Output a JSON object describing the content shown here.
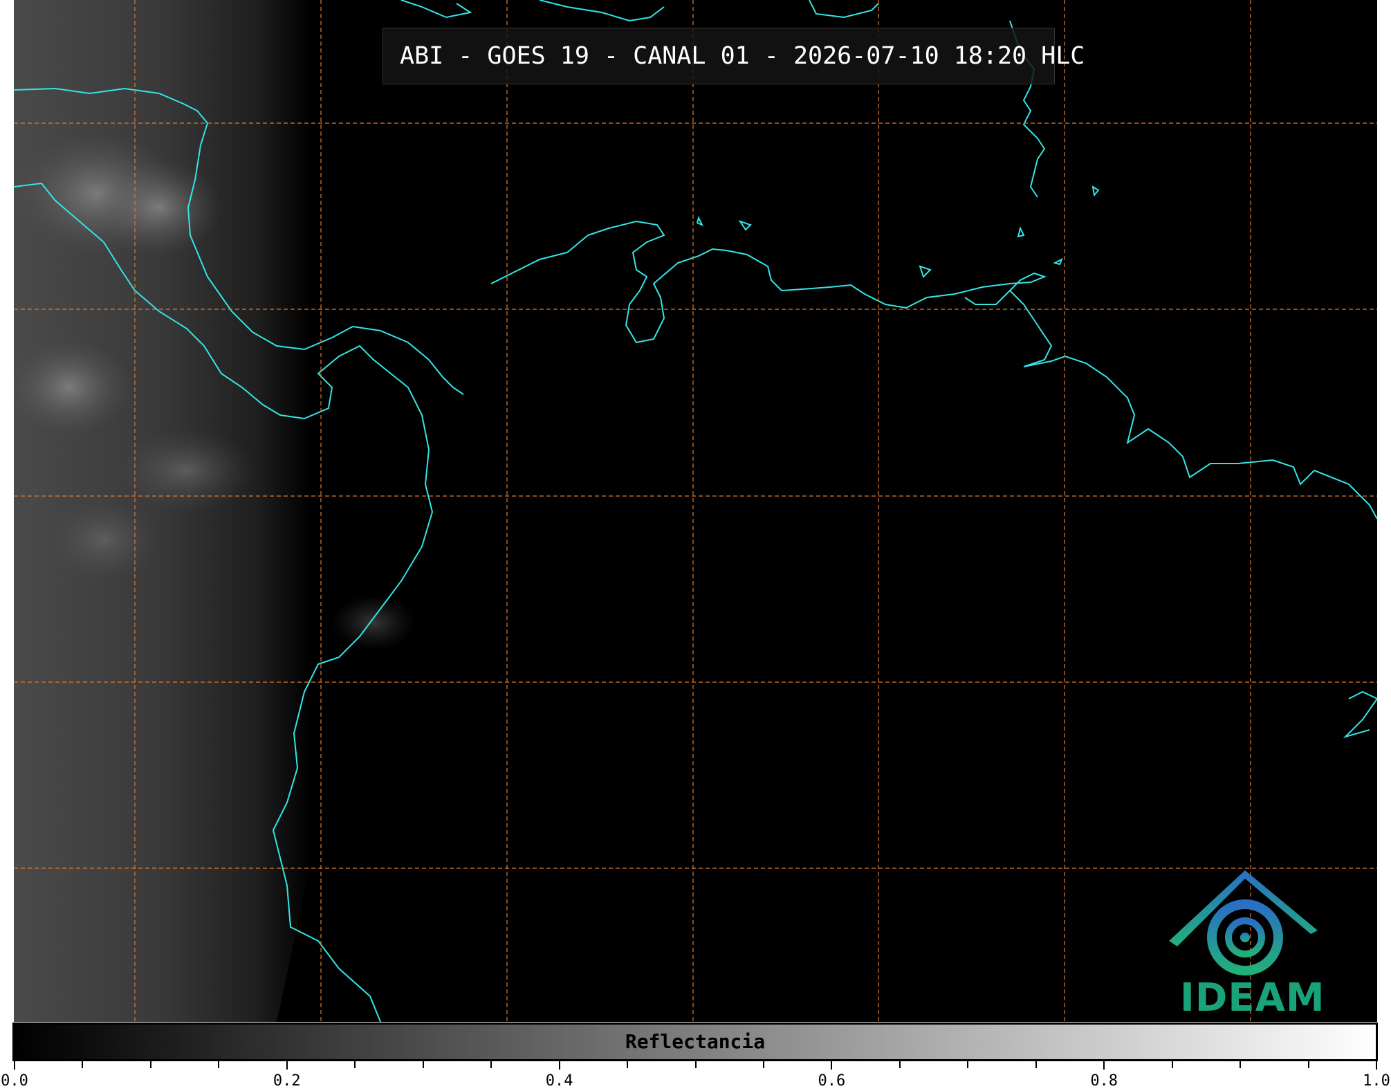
{
  "map": {
    "title": "ABI - GOES 19 - CANAL 01 - 2026-07-10 18:20 HLC",
    "coastline_color": "#33e6e6",
    "grid_color": "#e07a2e",
    "logo": {
      "name": "ideam-logo",
      "text": "IDEAM"
    }
  },
  "colorbar": {
    "label": "Reflectancia",
    "colormap": "grayscale",
    "range": [
      0.0,
      1.0
    ],
    "major_ticks": [
      "0.0",
      "0.2",
      "0.4",
      "0.6",
      "0.8",
      "1.0"
    ]
  }
}
